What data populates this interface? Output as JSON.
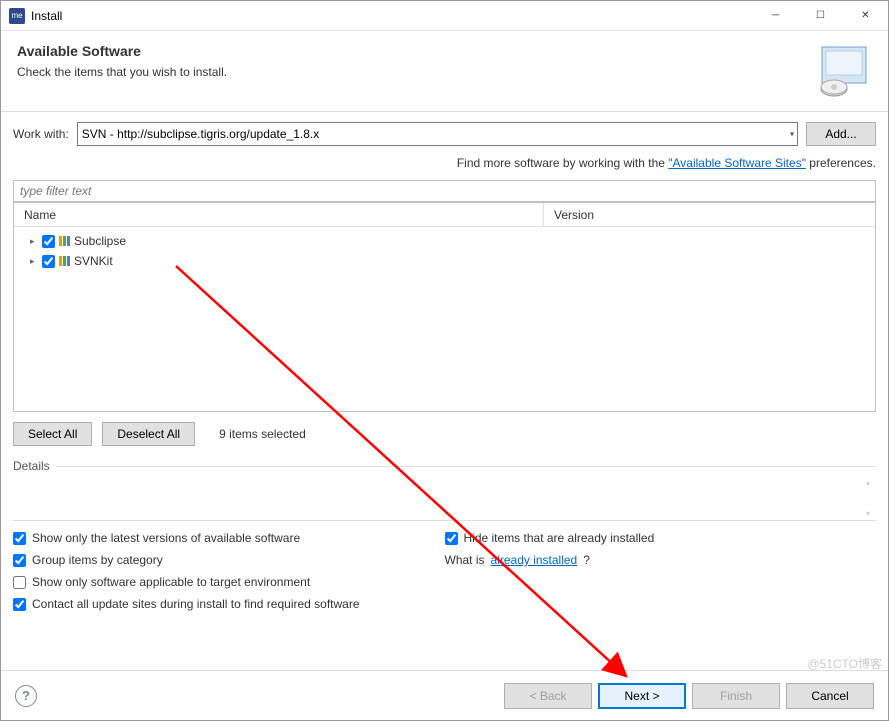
{
  "window": {
    "title": "Install",
    "appicon": "me"
  },
  "header": {
    "title": "Available Software",
    "subtitle": "Check the items that you wish to install."
  },
  "work_with": {
    "label": "Work with:",
    "value": "SVN - http://subclipse.tigris.org/update_1.8.x",
    "add_btn": "Add..."
  },
  "hint": {
    "prefix": "Find more software by working with the ",
    "link": "\"Available Software Sites\"",
    "suffix": " preferences."
  },
  "filter": {
    "placeholder": "type filter text"
  },
  "tree": {
    "columns": {
      "name": "Name",
      "version": "Version"
    },
    "items": [
      {
        "label": "Subclipse",
        "checked": true
      },
      {
        "label": "SVNKit",
        "checked": true
      }
    ]
  },
  "buttons": {
    "select_all": "Select All",
    "deselect_all": "Deselect All",
    "selected_count": "9 items selected"
  },
  "details_label": "Details",
  "options": {
    "latest": "Show only the latest versions of available software",
    "group": "Group items by category",
    "applicable": "Show only software applicable to target environment",
    "contact": "Contact all update sites during install to find required software",
    "hide": "Hide items that are already installed",
    "whatis_prefix": "What is ",
    "whatis_link": "already installed",
    "whatis_suffix": "?"
  },
  "footer": {
    "back": "< Back",
    "next": "Next >",
    "finish": "Finish",
    "cancel": "Cancel"
  },
  "watermark": "@51CTO博客"
}
